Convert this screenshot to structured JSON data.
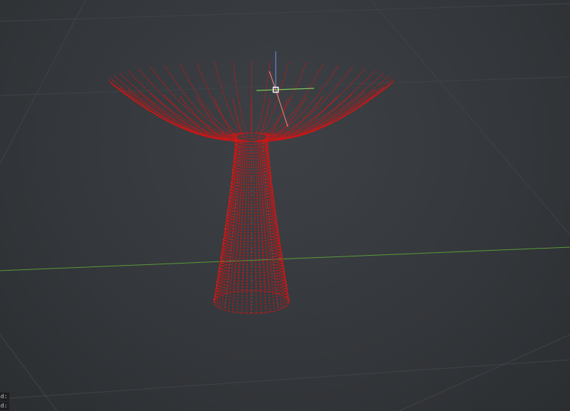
{
  "viewport": {
    "background": "#34373b",
    "grid_color": "#3f4347",
    "axis_x_color": "#5a9a3a",
    "model_color": "#d41414",
    "model_highlight": "#ff8a8a",
    "gizmo": {
      "x_color": "#7ec85a",
      "y_color": "#6a7fe0",
      "z_color": "#e07a7a",
      "center_color": "#ffffff"
    }
  },
  "command_history": [
    {
      "text": "nd:"
    },
    {
      "text": "nd:"
    }
  ]
}
